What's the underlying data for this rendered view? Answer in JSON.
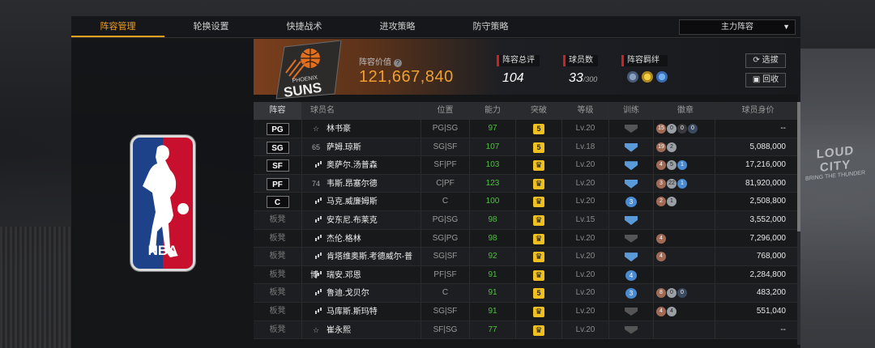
{
  "tabs": [
    "阵容管理",
    "轮换设置",
    "快捷战术",
    "进攻策略",
    "防守策略"
  ],
  "active_tab": 0,
  "lineup_select": "主力阵容",
  "team": {
    "logo_text_top": "PHOENIX",
    "logo_text_main": "SUNS",
    "value_label": "阵容价值",
    "value": "121,667,840"
  },
  "stats": {
    "overall_label": "阵容总评",
    "overall": "104",
    "count_label": "球员数",
    "count": "33",
    "count_max": "/300",
    "bond_label": "阵容羁绊"
  },
  "buttons": {
    "select": "选拔",
    "recycle": "回收"
  },
  "columns": [
    "阵容",
    "球员名",
    "位置",
    "能力",
    "突破",
    "等级",
    "训练",
    "徽章",
    "球员身价"
  ],
  "players": [
    {
      "slot": "PG",
      "starter": true,
      "pre": "☆",
      "name": "林书豪",
      "pos": "PG|SG",
      "ovr": "97",
      "brk": "5",
      "lv": "Lv.20",
      "train": "gray",
      "badges": [
        [
          "15",
          "bronze"
        ],
        [
          "0",
          "silver"
        ],
        [
          "0",
          "empty"
        ],
        [
          "0",
          "dark"
        ]
      ],
      "salary": "--"
    },
    {
      "slot": "SG",
      "starter": true,
      "pre": "65",
      "name": "萨姆.琼斯",
      "pos": "SG|SF",
      "ovr": "107",
      "brk": "5",
      "lv": "Lv.18",
      "train": "blue",
      "badges": [
        [
          "19",
          "bronze"
        ],
        [
          "2",
          "silver"
        ]
      ],
      "salary": "5,088,000"
    },
    {
      "slot": "SF",
      "starter": true,
      "pre": "bars",
      "name": "奥萨尔.汤普森",
      "pos": "SF|PF",
      "ovr": "103",
      "brk": "crown",
      "lv": "Lv.20",
      "train": "blue",
      "badges": [
        [
          "4",
          "bronze"
        ],
        [
          "5",
          "silver"
        ],
        [
          "1",
          "blue"
        ]
      ],
      "salary": "17,216,000"
    },
    {
      "slot": "PF",
      "starter": true,
      "pre": "74",
      "name": "韦斯.昂塞尔德",
      "pos": "C|PF",
      "ovr": "123",
      "brk": "crown",
      "lv": "Lv.20",
      "train": "blue",
      "badges": [
        [
          "3",
          "bronze"
        ],
        [
          "22",
          "silver"
        ],
        [
          "1",
          "blue"
        ]
      ],
      "salary": "81,920,000"
    },
    {
      "slot": "C",
      "starter": true,
      "pre": "bars",
      "name": "马克.威廉姆斯",
      "pos": "C",
      "ovr": "100",
      "brk": "crown",
      "lv": "Lv.20",
      "train": "3",
      "badges": [
        [
          "2",
          "bronze"
        ],
        [
          "1",
          "silver"
        ]
      ],
      "salary": "2,508,800"
    },
    {
      "slot": "板凳",
      "starter": false,
      "pre": "bars",
      "name": "安东尼.布莱克",
      "pos": "PG|SG",
      "ovr": "98",
      "brk": "crown",
      "lv": "Lv.15",
      "train": "blue",
      "badges": [],
      "salary": "3,552,000"
    },
    {
      "slot": "板凳",
      "starter": false,
      "pre": "bars",
      "name": "杰伦.格林",
      "pos": "SG|PG",
      "ovr": "98",
      "brk": "crown",
      "lv": "Lv.20",
      "train": "gray",
      "badges": [
        [
          "4",
          "bronze"
        ]
      ],
      "salary": "7,296,000"
    },
    {
      "slot": "板凳",
      "starter": false,
      "pre": "bars",
      "name": "肯塔维奥斯.考德威尔-普博",
      "pos": "SG|SF",
      "ovr": "92",
      "brk": "crown",
      "lv": "Lv.20",
      "train": "blue",
      "badges": [
        [
          "4",
          "bronze"
        ]
      ],
      "salary": "768,000"
    },
    {
      "slot": "板凳",
      "starter": false,
      "pre": "bars",
      "name": "瑞安.邓恩",
      "pos": "PF|SF",
      "ovr": "91",
      "brk": "crown",
      "lv": "Lv.20",
      "train": "4",
      "badges": [],
      "salary": "2,284,800"
    },
    {
      "slot": "板凳",
      "starter": false,
      "pre": "bars",
      "name": "鲁迪.戈贝尔",
      "pos": "C",
      "ovr": "91",
      "brk": "5",
      "lv": "Lv.20",
      "train": "3",
      "badges": [
        [
          "8",
          "bronze"
        ],
        [
          "0",
          "silver"
        ],
        [
          "0",
          "dark"
        ]
      ],
      "salary": "483,200"
    },
    {
      "slot": "板凳",
      "starter": false,
      "pre": "bars",
      "name": "马库斯.斯玛特",
      "pos": "SG|SF",
      "ovr": "91",
      "brk": "crown",
      "lv": "Lv.20",
      "train": "gray",
      "badges": [
        [
          "4",
          "bronze"
        ],
        [
          "4",
          "silver"
        ]
      ],
      "salary": "551,040"
    },
    {
      "slot": "板凳",
      "starter": false,
      "pre": "☆",
      "name": "崔永熙",
      "pos": "SF|SG",
      "ovr": "77",
      "brk": "crown",
      "lv": "Lv.20",
      "train": "gray",
      "badges": [],
      "salary": "--"
    }
  ],
  "arena_sign": {
    "main": "LOUD CITY",
    "sub": "BRING THE THUNDER"
  }
}
